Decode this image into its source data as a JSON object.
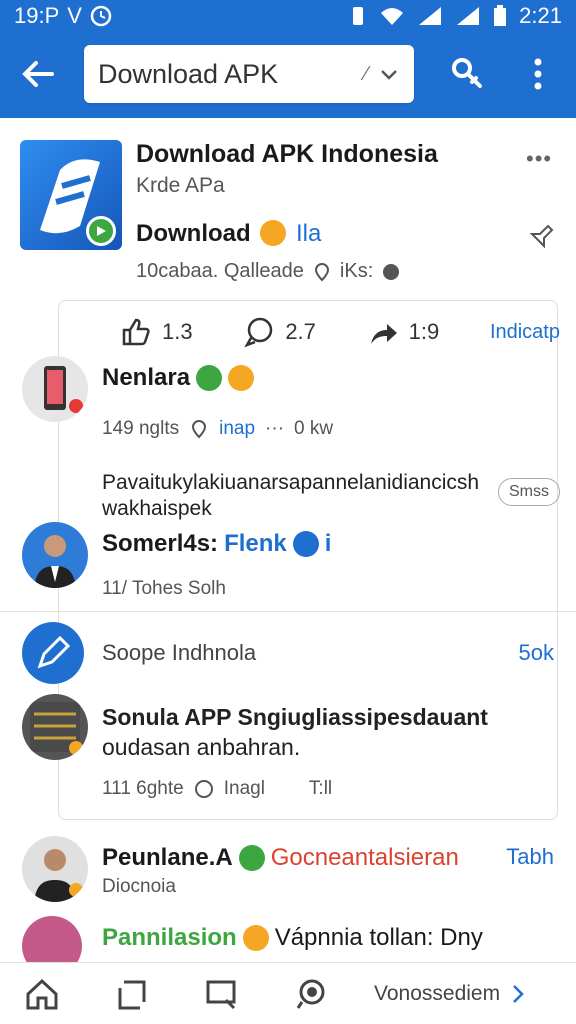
{
  "status_bar": {
    "time": "19:P",
    "right_time": "2:21"
  },
  "search": {
    "query": "Download APK"
  },
  "app": {
    "title": "Download APK Indonesia",
    "subtitle": "Krde APa",
    "download_label": "Download",
    "download_link": "Ila",
    "meta": "10cabaa. Qalleade",
    "meta_tail": "iKs:"
  },
  "actions": {
    "like_count": "1.3",
    "comment_count": "2.7",
    "share_count": "1:9",
    "link_label": "Indicatp"
  },
  "comments": [
    {
      "name": "Nenlara",
      "time": "149 nglts",
      "meta2": "inap",
      "meta3": "0 kw",
      "text": "Pavaitukylakiuanarsapannelanidiancicsh wakhaispek"
    },
    {
      "name": "Somerl4s:",
      "tag": "Flenk",
      "tag_tail": "i",
      "time": "11/ Tohes Solh"
    }
  ],
  "pill": "Smss",
  "section": {
    "label": "Soope Indhnola",
    "count": "5ok"
  },
  "post": {
    "title": "Sonula APP Sngiugliassipesdauant",
    "line2": "oudasan anbahran.",
    "time": "111 6ghte",
    "meta2": "Inagl",
    "meta3": "T:ll"
  },
  "more_comments": [
    {
      "name": "Peunlane.A",
      "tag": "Gocneantalsieran",
      "right": "Tabh",
      "sub": "Diocnoia"
    },
    {
      "name": "Pannilasion",
      "text": "Vápnnia tollan: Dny"
    }
  ],
  "bottom_nav": {
    "label": "Vonossediem"
  },
  "colors": {
    "accent": "#1f6fd0",
    "green": "#3ea640",
    "orange": "#f5a623",
    "red_tag": "#d9432f"
  }
}
